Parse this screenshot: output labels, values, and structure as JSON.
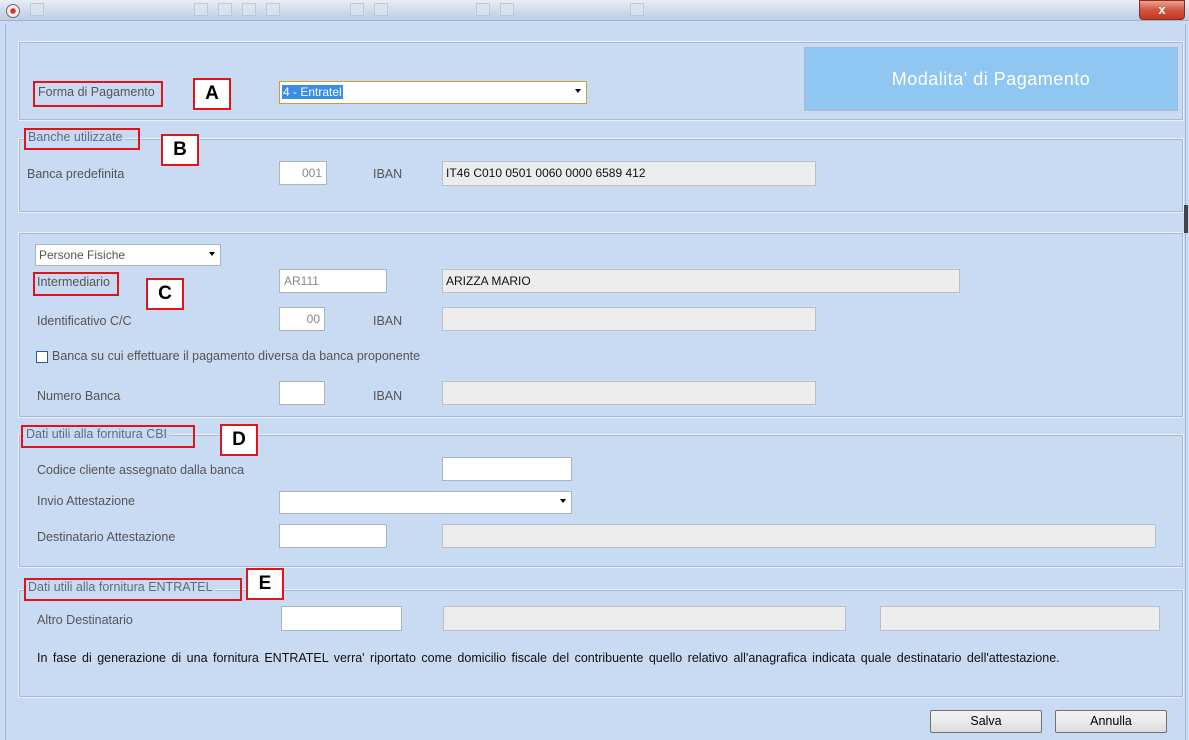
{
  "title_bar": {
    "close_label": "x"
  },
  "header": {
    "title": "Modalita' di Pagamento"
  },
  "section_a": {
    "letter": "A",
    "label": "Forma di Pagamento",
    "select_value": "4 - Entratel"
  },
  "section_b": {
    "letter": "B",
    "group_title": "Banche utilizzate",
    "bank_label": "Banca predefinita",
    "bank_value": "001",
    "iban_label": "IBAN",
    "iban_value": "IT46 C010 0501 0060 0000 6589 412"
  },
  "section_c": {
    "letter": "C",
    "person_type_select": "Persone Fisiche",
    "intermediary_label": "Intermediario",
    "intermediary_code": "AR111",
    "intermediary_name": "ARIZZA MARIO",
    "account_label": "Identificativo C/C",
    "account_value": "00",
    "iban_label": "IBAN",
    "iban_value": "",
    "checkbox_label": "Banca su cui effettuare il pagamento diversa da banca proponente",
    "bank_number_label": "Numero Banca",
    "bank_number_value": "",
    "iban2_label": "IBAN",
    "iban2_value": ""
  },
  "section_d": {
    "letter": "D",
    "group_title": "Dati utili alla fornitura CBI",
    "client_code_label": "Codice cliente assegnato dalla banca",
    "attestation_send_label": "Invio Attestazione",
    "attestation_recipient_label": "Destinatario Attestazione"
  },
  "section_e": {
    "letter": "E",
    "group_title": "Dati utili alla fornitura ENTRATEL",
    "other_recipient_label": "Altro Destinatario",
    "note": "In fase di generazione di una fornitura ENTRATEL verra' riportato come domicilio fiscale del contribuente quello relativo all'anagrafica indicata quale destinatario dell'attestazione."
  },
  "footer": {
    "save_label": "Salva",
    "cancel_label": "Annulla"
  },
  "colors": {
    "background": "#c9daf3",
    "header_box": "#8fc6f2",
    "highlight": "#e0141a"
  },
  "icons": [
    "app-icon",
    "close-icon",
    "chevron-down-icon",
    "checkbox"
  ]
}
